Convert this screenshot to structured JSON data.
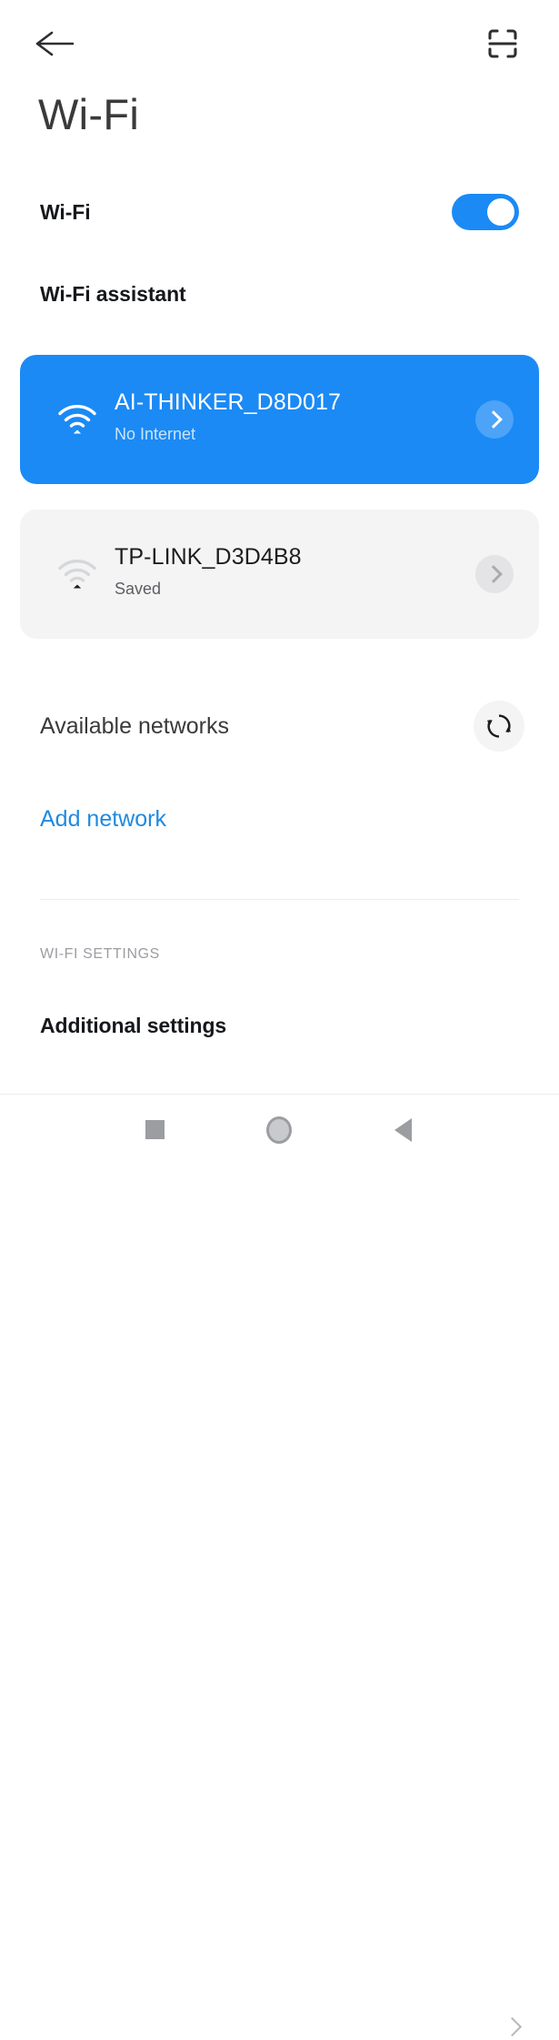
{
  "appbar": {
    "back_icon": "arrow-left-icon",
    "scan_icon": "qr-scan-icon"
  },
  "page_title": "Wi-Fi",
  "rows": {
    "wifi": {
      "label": "Wi-Fi",
      "toggle_state": "on"
    },
    "assistant": {
      "label": "Wi-Fi assistant",
      "chevron_icon": "chevron-right-icon"
    },
    "additional_settings": {
      "label": "Additional settings",
      "chevron_icon": "chevron-right-icon"
    }
  },
  "networks": [
    {
      "ssid": "AI-THINKER_D8D017",
      "status": "No Internet",
      "state": "connected",
      "signal_icon": "wifi-full-icon",
      "chevron_icon": "chevron-right-icon"
    },
    {
      "ssid": "TP-LINK_D3D4B8",
      "status": "Saved",
      "state": "saved",
      "signal_icon": "wifi-weak-icon",
      "chevron_icon": "chevron-right-icon"
    }
  ],
  "available_networks": {
    "label": "Available networks",
    "refresh_icon": "refresh-icon"
  },
  "add_network": {
    "label": "Add network"
  },
  "section_caption": "WI-FI SETTINGS",
  "navbar": {
    "recents_icon": "square-recents-icon",
    "home_icon": "circle-home-icon",
    "back_icon": "triangle-back-icon"
  },
  "colors": {
    "accent_blue": "#1b8af5",
    "link_blue": "#1f8ae0",
    "card_gray": "#f4f4f5",
    "text_primary": "#16181c",
    "text_muted": "#9b9da1"
  }
}
